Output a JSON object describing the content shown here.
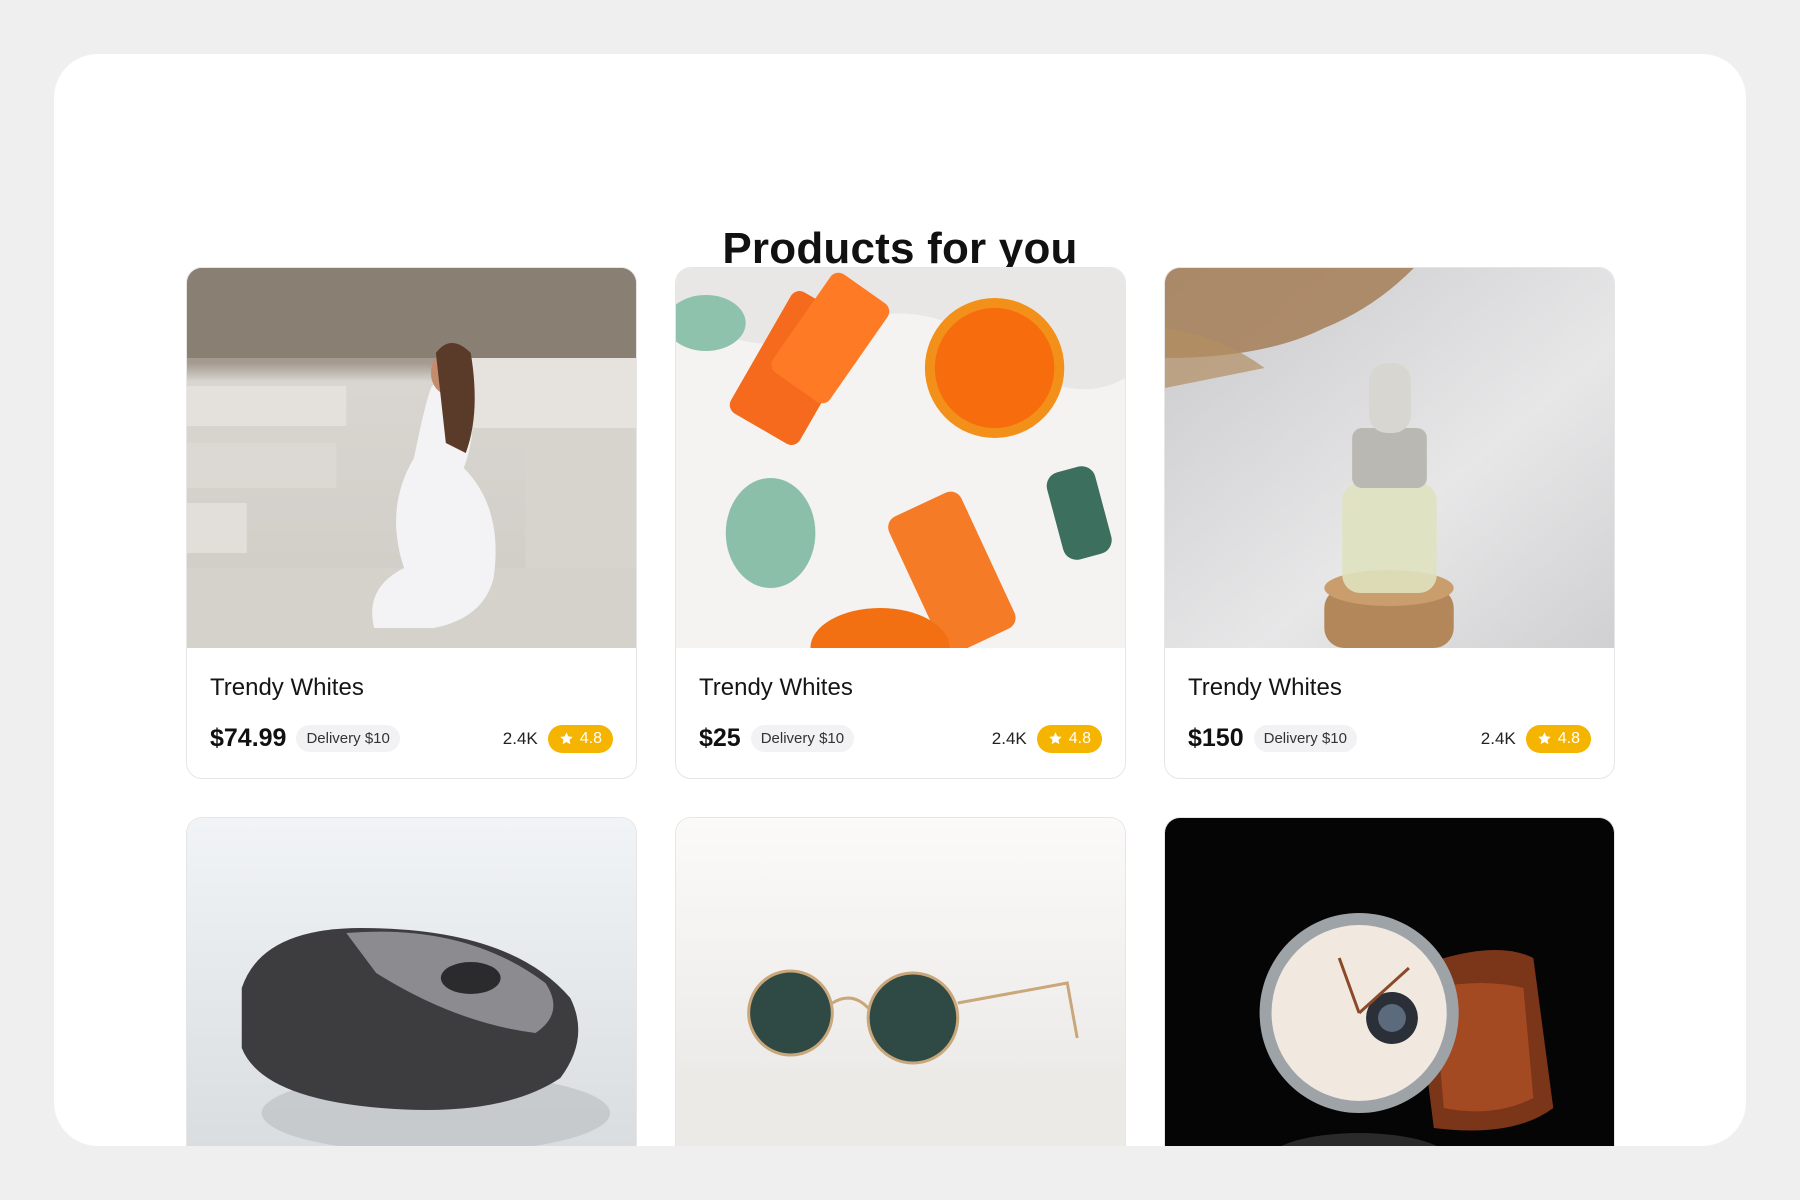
{
  "page": {
    "title": "Products for you"
  },
  "colors": {
    "background": "#efefef",
    "panel": "#ffffff",
    "rating": "#f5b400"
  },
  "products": [
    {
      "name": "Trendy Whites",
      "price": "$74.99",
      "delivery": "Delivery $10",
      "count": "2.4K",
      "rating": "4.8",
      "image_icon": "woman-in-white-photo"
    },
    {
      "name": "Trendy Whites",
      "price": "$25",
      "delivery": "Delivery $10",
      "count": "2.4K",
      "rating": "4.8",
      "image_icon": "skincare-orange-photo"
    },
    {
      "name": "Trendy Whites",
      "price": "$150",
      "delivery": "Delivery $10",
      "count": "2.4K",
      "rating": "4.8",
      "image_icon": "serum-bottle-photo"
    },
    {
      "image_icon": "computer-mouse-photo"
    },
    {
      "image_icon": "sunglasses-photo"
    },
    {
      "image_icon": "wristwatch-photo"
    }
  ]
}
